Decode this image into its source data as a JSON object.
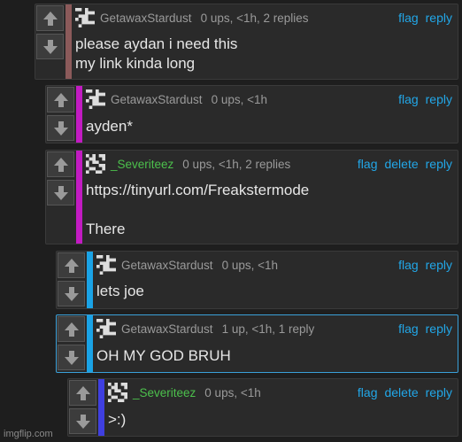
{
  "comments": [
    {
      "user": "GetawaxStardust",
      "meta": "0 ups, <1h, 2 replies",
      "actions": [
        "flag",
        "reply"
      ],
      "body_lines": [
        "please aydan i need this",
        "my link kinda long"
      ],
      "bar_color": "#8b5a5a",
      "user_color": "gray"
    },
    {
      "user": "GetawaxStardust",
      "meta": "0 ups, <1h",
      "actions": [
        "flag",
        "reply"
      ],
      "body_lines": [
        "ayden*"
      ],
      "bar_color": "#c21bc2",
      "user_color": "gray"
    },
    {
      "user": "_Severiteez",
      "meta": "0 ups, <1h, 2 replies",
      "actions": [
        "flag",
        "delete",
        "reply"
      ],
      "body_lines": [
        "https://tinyurl.com/Freakstermode",
        "",
        "There"
      ],
      "bar_color": "#c21bc2",
      "user_color": "green"
    },
    {
      "user": "GetawaxStardust",
      "meta": "0 ups, <1h",
      "actions": [
        "flag",
        "reply"
      ],
      "body_lines": [
        "lets joe"
      ],
      "bar_color": "#1aa3e6",
      "user_color": "gray"
    },
    {
      "user": "GetawaxStardust",
      "meta": "1 up, <1h, 1 reply",
      "actions": [
        "flag",
        "reply"
      ],
      "body_lines": [
        "OH MY GOD BRUH"
      ],
      "bar_color": "#1aa3e6",
      "user_color": "gray"
    },
    {
      "user": "_Severiteez",
      "meta": "0 ups, <1h",
      "actions": [
        "flag",
        "delete",
        "reply"
      ],
      "body_lines": [
        ">:)"
      ],
      "bar_color": "#3f3fe0",
      "user_color": "green"
    }
  ],
  "watermark": "imgflip.com",
  "icons": {
    "upvote": "arrow-up-icon",
    "downvote": "arrow-down-icon",
    "avatar": "pixel-avatar-icon"
  }
}
